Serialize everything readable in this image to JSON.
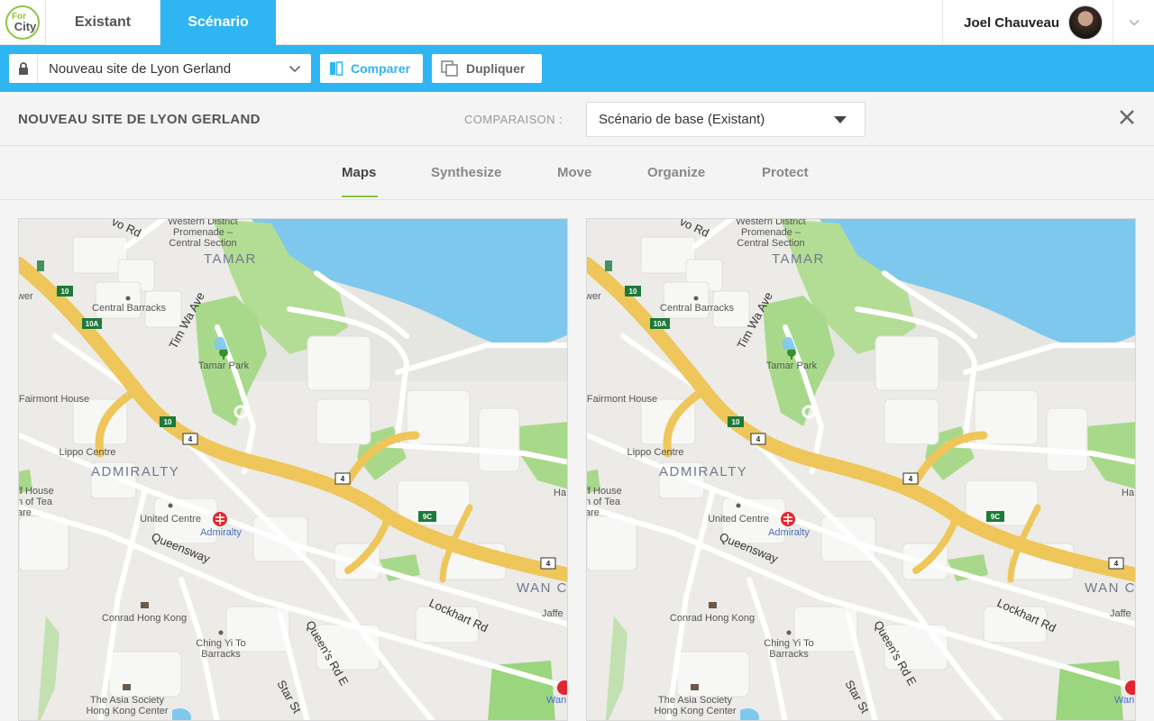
{
  "app": {
    "logo_line1": "For",
    "logo_line2": "City"
  },
  "topbar": {
    "tabs": [
      {
        "label": "Existant",
        "active": false
      },
      {
        "label": "Scénario",
        "active": true
      }
    ],
    "user_name": "Joel Chauveau"
  },
  "toolbar": {
    "site_name": "Nouveau site de Lyon Gerland",
    "compare_label": "Comparer",
    "duplicate_label": "Dupliquer"
  },
  "comparison": {
    "title": "NOUVEAU SITE DE LYON GERLAND",
    "label": "COMPARAISON :",
    "selected": "Scénario de base (Existant)"
  },
  "subtabs": [
    {
      "label": "Maps",
      "active": true
    },
    {
      "label": "Synthesize",
      "active": false
    },
    {
      "label": "Move",
      "active": false
    },
    {
      "label": "Organize",
      "active": false
    },
    {
      "label": "Protect",
      "active": false
    }
  ],
  "map": {
    "districts": [
      "TAMAR",
      "ADMIRALTY",
      "WAN C"
    ],
    "places": [
      "Western District",
      "Promenade –",
      "Central Section",
      "Central Barracks",
      "Tamar Park",
      "Fairmont House",
      "Lippo Centre",
      "United Centre",
      "Admiralty",
      "Conrad Hong Kong",
      "Ching Yi To",
      "Barracks",
      "The Asia Society",
      "Hong Kong Center",
      "ff House",
      "n of Tea",
      "are",
      "wer",
      "Jaffe",
      "Ha",
      "Wan"
    ],
    "roads": [
      "Tim Wa Ave",
      "Queensway",
      "Lockhart Rd",
      "Queen's Rd E",
      "Star St",
      "vo Rd"
    ],
    "shields": [
      "10",
      "10A",
      "10",
      "4",
      "4",
      "9C",
      "4"
    ]
  },
  "colors": {
    "accent_blue": "#2eb5f2",
    "brand_green": "#8cc63f",
    "water": "#7ec8ee",
    "park": "#a8d98a",
    "highway": "#eec65a"
  }
}
